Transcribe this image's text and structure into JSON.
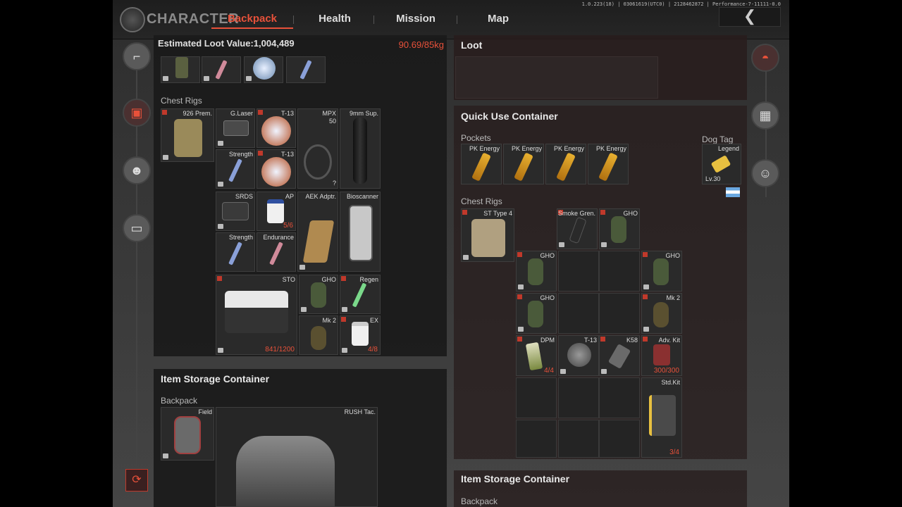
{
  "header": {
    "title": "CHARACTER",
    "tabs": [
      {
        "label": "Backpack"
      },
      {
        "label": "Health"
      },
      {
        "label": "Mission"
      },
      {
        "label": "Map"
      }
    ],
    "version": "1.0.223(18) | 03061619(UTC0) | 2128462872 | Performance-7-11111-0.0",
    "back_glyph": "❮"
  },
  "left_panel": {
    "loot_value": "Estimated Loot Value:1,004,489",
    "weight": "90.69/85kg",
    "chest_rigs_label": "Chest Rigs",
    "items": {
      "rig": "926 Prem.",
      "glaser": "G.Laser",
      "t13a": "T-13",
      "mpx": "MPX",
      "mpx_count": "50",
      "sup": "9mm Sup.",
      "strength1": "Strength",
      "t13b": "T-13",
      "mpx_q": "?",
      "srds": "SRDS",
      "ap": "AP",
      "ap_count": "5/6",
      "aek": "AEK Adptr.",
      "bioscanner": "Bioscanner",
      "strength2": "Strength",
      "endurance": "Endurance",
      "sto": "STO",
      "sto_count": "841/1200",
      "gho": "GHO",
      "regen": "Regen",
      "mk2": "Mk 2",
      "ex": "EX",
      "ex_count": "4/8"
    }
  },
  "left_storage": {
    "title": "Item Storage Container",
    "backpack_label": "Backpack",
    "field": "Field",
    "rush": "RUSH Tac."
  },
  "loot_panel": {
    "title": "Loot"
  },
  "quick_use": {
    "title": "Quick Use Container",
    "pockets_label": "Pockets",
    "pockets": [
      "PK Energy",
      "PK Energy",
      "PK Energy",
      "PK Energy"
    ],
    "dog_tag_label": "Dog Tag",
    "dog_tag_item": "Legend",
    "dog_tag_level": "Lv.30",
    "chest_rigs_label": "Chest Rigs",
    "rig": "ST Type 4",
    "smoke": "Smoke Gren.",
    "gho_top": "GHO",
    "gho_r1_left": "GHO",
    "gho_r1_right": "GHO",
    "gho_r2_left": "GHO",
    "mk2": "Mk 2",
    "dpm": "DPM",
    "dpm_count": "4/4",
    "t13": "T-13",
    "k58": "K58",
    "adv_kit": "Adv. Kit",
    "adv_count": "300/300",
    "std_kit": "Std.Kit",
    "std_count": "3/4"
  },
  "right_storage": {
    "title": "Item Storage Container",
    "backpack_label": "Backpack"
  },
  "sidebar": {
    "left_icons": [
      "pistol-icon",
      "backpack-icon",
      "mask-icon",
      "toolbox-icon",
      "backpack-refresh-icon"
    ],
    "right_icons": [
      "helmet-icon",
      "vest-icon",
      "face-icon"
    ]
  }
}
